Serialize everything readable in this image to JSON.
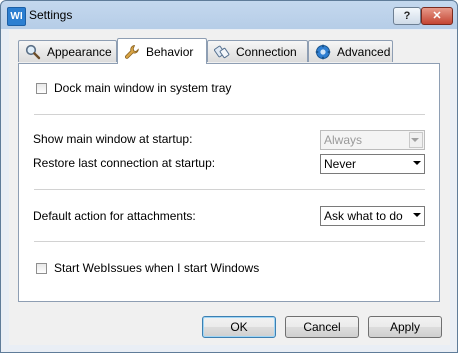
{
  "window": {
    "title": "Settings",
    "app_icon_text": "WI"
  },
  "titlebar_buttons": {
    "help": "?",
    "close": "✕"
  },
  "tabs": [
    {
      "label": "Appearance",
      "icon": "magnifier-icon",
      "active": false
    },
    {
      "label": "Behavior",
      "icon": "wrench-icon",
      "active": true
    },
    {
      "label": "Connection",
      "icon": "connection-icon",
      "active": false
    },
    {
      "label": "Advanced",
      "icon": "gear-icon",
      "active": false
    }
  ],
  "behavior": {
    "dock_tray": {
      "label": "Dock main window in system tray",
      "checked": false
    },
    "show_main_window": {
      "label": "Show main window at startup:",
      "value": "Always",
      "enabled": false
    },
    "restore_connection": {
      "label": "Restore last connection at startup:",
      "value": "Never"
    },
    "attachments": {
      "label": "Default action for attachments:",
      "value": "Ask what to do"
    },
    "start_with_windows": {
      "label": "Start WebIssues when I start Windows",
      "checked": false
    }
  },
  "buttons": {
    "ok": "OK",
    "cancel": "Cancel",
    "apply": "Apply"
  }
}
